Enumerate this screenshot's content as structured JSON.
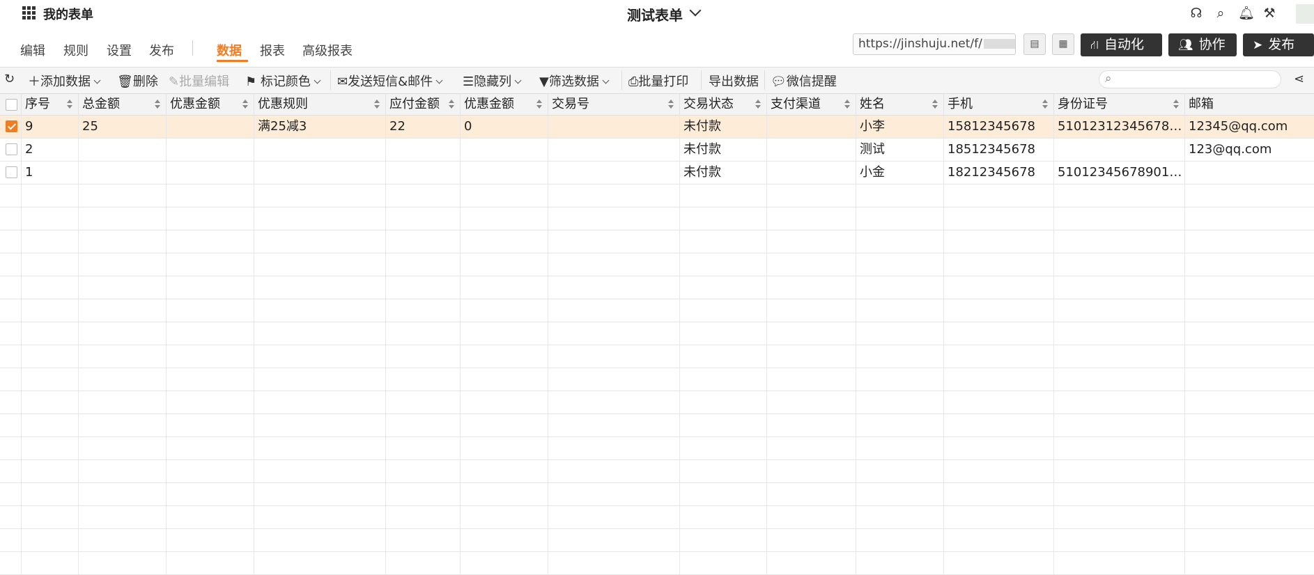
{
  "topbar": {
    "my_forms": "我的表单",
    "form_title": "测试表单",
    "icons": [
      "headset-icon",
      "search-icon",
      "bell-icon",
      "tools-icon"
    ]
  },
  "nav": {
    "tabs": [
      "编辑",
      "规则",
      "设置",
      "发布",
      "数据",
      "报表",
      "高级报表"
    ],
    "active": "数据",
    "url": "https://jinshuju.net/f/",
    "automation": "自动化",
    "collaborate": "协作",
    "publish": "发布"
  },
  "toolbar": {
    "add_data": "添加数据",
    "delete": "删除",
    "batch_edit": "批量编辑",
    "mark_color": "标记颜色",
    "send_sms_email": "发送短信&邮件",
    "hide_columns": "隐藏列",
    "filter_data": "筛选数据",
    "batch_print": "批量打印",
    "export_data": "导出数据",
    "wechat_remind": "微信提醒"
  },
  "table": {
    "columns": [
      "序号",
      "总金额",
      "优惠金额",
      "优惠规则",
      "应付金额",
      "优惠金额",
      "交易号",
      "交易状态",
      "支付渠道",
      "姓名",
      "手机",
      "身份证号",
      "邮箱"
    ],
    "rows": [
      {
        "selected": true,
        "cells": [
          "9",
          "25",
          "",
          "满25减3",
          "22",
          "0",
          "",
          "未付款",
          "",
          "小李",
          "15812345678",
          "5101231234567890...",
          "12345@qq.com"
        ]
      },
      {
        "selected": false,
        "cells": [
          "2",
          "",
          "",
          "",
          "",
          "",
          "",
          "未付款",
          "",
          "测试",
          "18512345678",
          "",
          "123@qq.com"
        ]
      },
      {
        "selected": false,
        "cells": [
          "1",
          "",
          "",
          "",
          "",
          "",
          "",
          "未付款",
          "",
          "小金",
          "18212345678",
          "5101234567890123...",
          ""
        ]
      }
    ]
  },
  "colors": {
    "accent": "#f07d22",
    "selected_row": "#fdecd8",
    "dark_button": "#333333"
  }
}
